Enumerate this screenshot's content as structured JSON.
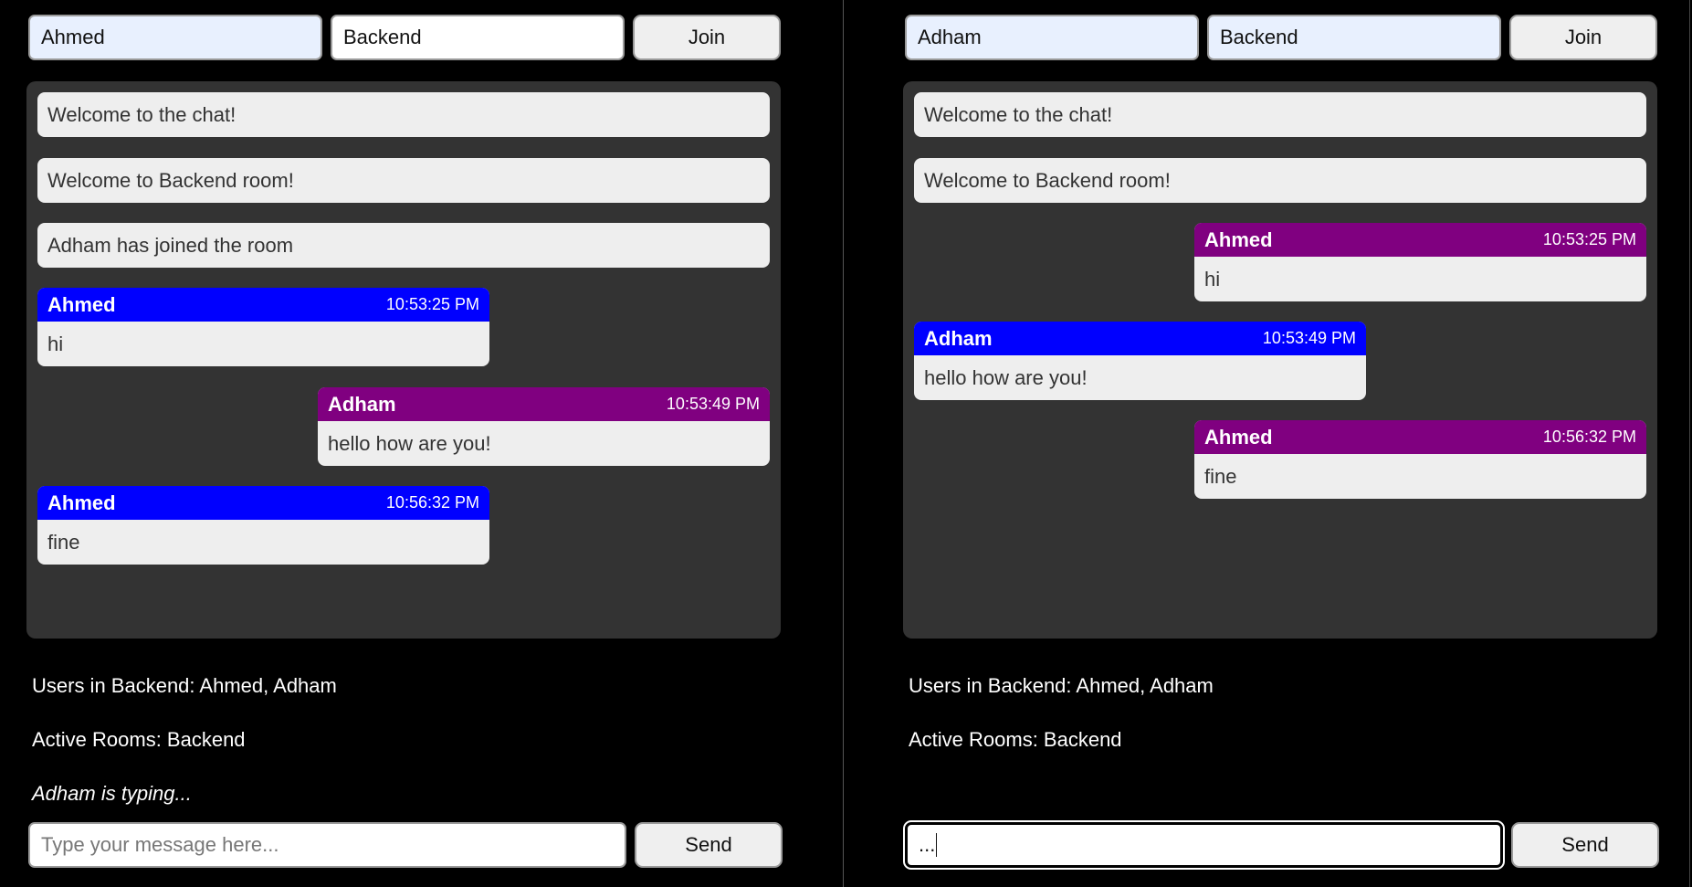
{
  "left": {
    "name_value": "Ahmed",
    "room_value": "Backend",
    "join_label": "Join",
    "system_messages": [
      "Welcome to the chat!",
      "Welcome to Backend room!",
      "Adham has joined the room"
    ],
    "messages": [
      {
        "user": "Ahmed",
        "time": "10:53:25 PM",
        "text": "hi"
      },
      {
        "user": "Adham",
        "time": "10:53:49 PM",
        "text": "hello how are you!"
      },
      {
        "user": "Ahmed",
        "time": "10:56:32 PM",
        "text": "fine"
      }
    ],
    "users_text": "Users in Backend: Ahmed, Adham",
    "rooms_text": "Active Rooms: Backend",
    "typing_text": "Adham is typing...",
    "message_placeholder": "Type your message here...",
    "send_label": "Send"
  },
  "right": {
    "name_value": "Adham",
    "room_value": "Backend",
    "join_label": "Join",
    "system_messages": [
      "Welcome to the chat!",
      "Welcome to Backend room!"
    ],
    "messages": [
      {
        "user": "Ahmed",
        "time": "10:53:25 PM",
        "text": "hi"
      },
      {
        "user": "Adham",
        "time": "10:53:49 PM",
        "text": "hello how are you!"
      },
      {
        "user": "Ahmed",
        "time": "10:56:32 PM",
        "text": "fine"
      }
    ],
    "users_text": "Users in Backend: Ahmed, Adham",
    "rooms_text": "Active Rooms: Backend",
    "message_value": "...",
    "send_label": "Send"
  },
  "colors": {
    "own_header": "#0000ff",
    "other_header": "#800080",
    "chat_bg": "#333333",
    "bubble_bg": "#eeeeee"
  }
}
